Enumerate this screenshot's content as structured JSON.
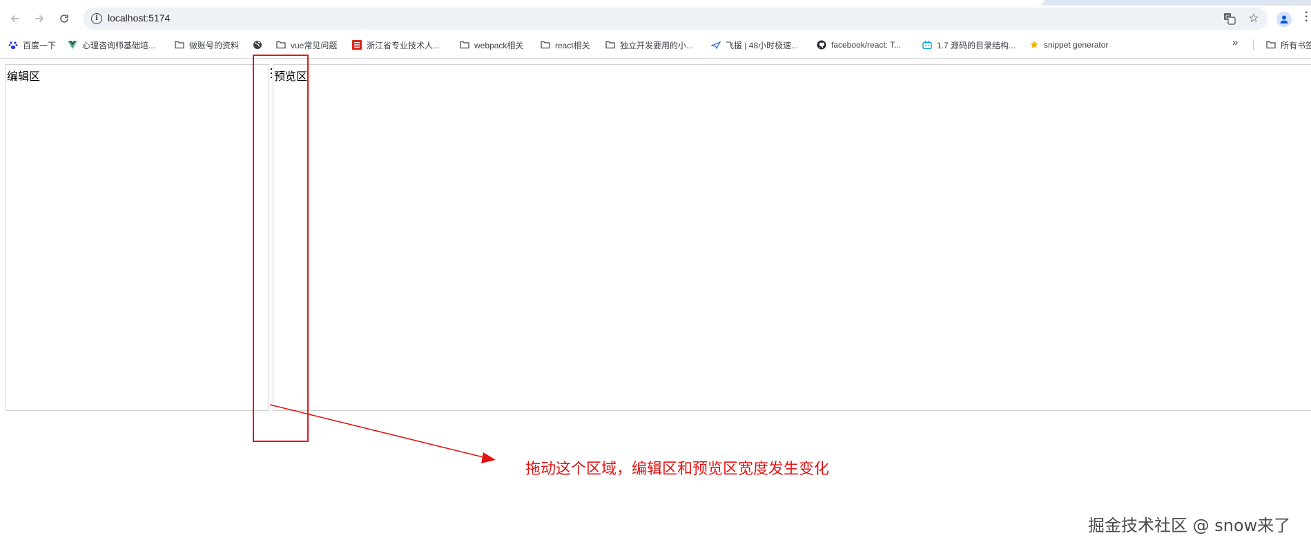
{
  "browser": {
    "url": "localhost:5174",
    "bookmarks": [
      {
        "label": "百度一下",
        "icon": "baidu-paw-icon"
      },
      {
        "label": "心理咨询师基础培...",
        "icon": "vue-logo-icon"
      },
      {
        "label": "做账号的资料",
        "icon": "folder-icon"
      },
      {
        "label": "",
        "icon": "globe-icon"
      },
      {
        "label": "vue常见问题",
        "icon": "folder-icon"
      },
      {
        "label": "浙江省专业技术人...",
        "icon": "zhejiang-site-icon"
      },
      {
        "label": "webpack相关",
        "icon": "folder-icon"
      },
      {
        "label": "react相关",
        "icon": "folder-icon"
      },
      {
        "label": "独立开发要用的小...",
        "icon": "folder-icon"
      },
      {
        "label": "飞援 | 48小时极速...",
        "icon": "feiyuan-icon"
      },
      {
        "label": "facebook/react: T...",
        "icon": "github-icon"
      },
      {
        "label": "1.7 源码的目录结构...",
        "icon": "bilibili-icon"
      },
      {
        "label": "snippet generator",
        "icon": "snippet-icon"
      },
      {
        "label": "所有书签",
        "icon": "folder-icon"
      }
    ]
  },
  "page": {
    "editor_label": "编辑区",
    "preview_label": "预览区"
  },
  "annotation": {
    "text": "拖动这个区域，编辑区和预览区宽度发生变化",
    "color": "#e11414"
  },
  "watermark": "掘金技术社区 @ snow来了"
}
